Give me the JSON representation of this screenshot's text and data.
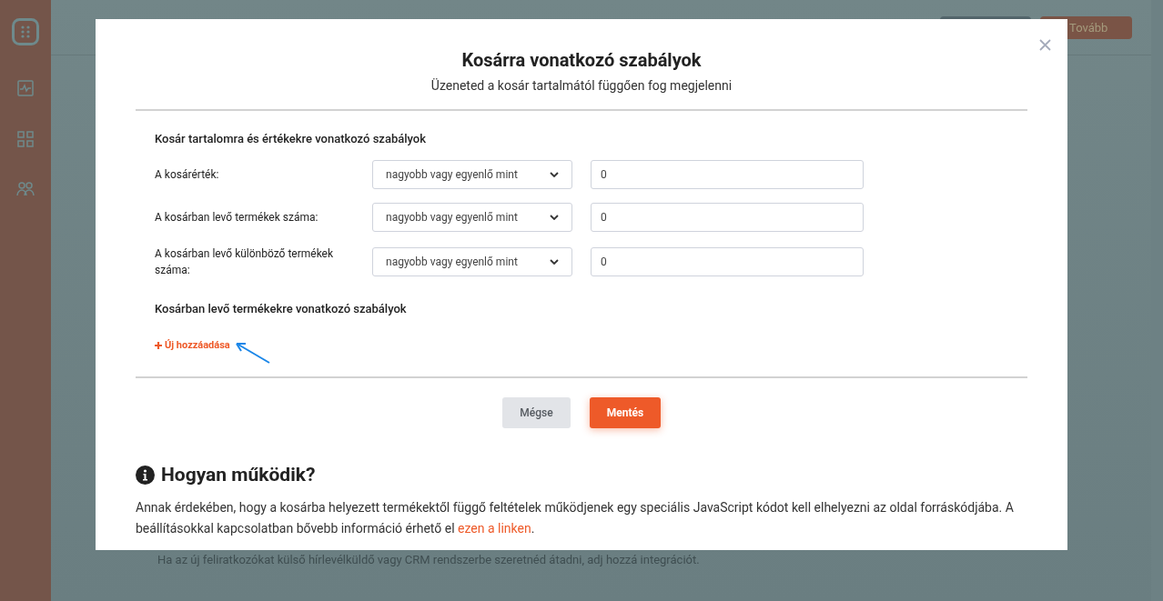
{
  "background": {
    "next_button": "Tovább",
    "hint": "Ha az új feliratkozókat külső hírlevélküldő vagy CRM rendszerbe szeretnéd átadni, adj hozzá integrációt."
  },
  "dialog": {
    "title": "Kosárra vonatkozó szabályok",
    "subtitle": "Üzeneted a kosár tartalmától függően fog megjelenni",
    "section_title": "Kosár tartalomra és értékekre vonatkozó szabályok",
    "rules": [
      {
        "label": "A kosárérték:",
        "operator": "nagyobb vagy egyenlő mint",
        "value": "0"
      },
      {
        "label": "A kosárban levő termékek száma:",
        "operator": "nagyobb vagy egyenlő mint",
        "value": "0"
      },
      {
        "label": "A kosárban levő különböző termékek száma:",
        "operator": "nagyobb vagy egyenlő mint",
        "value": "0"
      }
    ],
    "products_title": "Kosárban levő termékekre vonatkozó szabályok",
    "add_link": "Új hozzáadása",
    "buttons": [
      {
        "kind": "secondary",
        "label": "Mégse"
      },
      {
        "kind": "primary",
        "label": "Mentés"
      }
    ],
    "help_title": "Hogyan működik?",
    "help_text": "Annak érdekében, hogy a kosárba helyezett termékektől függő feltételek működjenek egy speciális JavaScript kódot kell elhelyezni az oldal forráskódjába. A beállításokkal kapcsolatban bővebb információ érhető el",
    "help_link": "ezen a linken",
    "help_end": "."
  }
}
